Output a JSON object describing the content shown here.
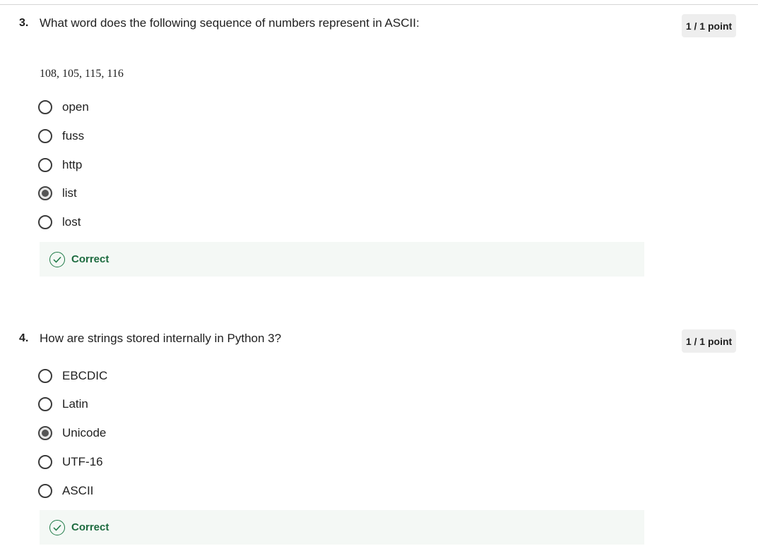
{
  "questions": [
    {
      "number": "3.",
      "text": "What word does the following sequence of numbers represent in ASCII:",
      "points": "1 / 1 point",
      "sub_text": "108, 105, 115, 116",
      "options": [
        {
          "label": "open",
          "selected": false
        },
        {
          "label": "fuss",
          "selected": false
        },
        {
          "label": "http",
          "selected": false
        },
        {
          "label": "list",
          "selected": true
        },
        {
          "label": "lost",
          "selected": false
        }
      ],
      "feedback": "Correct"
    },
    {
      "number": "4.",
      "text": "How are strings stored internally in Python 3?",
      "points": "1 / 1 point",
      "options": [
        {
          "label": "EBCDIC",
          "selected": false
        },
        {
          "label": "Latin",
          "selected": false
        },
        {
          "label": "Unicode",
          "selected": true
        },
        {
          "label": "UTF-16",
          "selected": false
        },
        {
          "label": "ASCII",
          "selected": false
        }
      ],
      "feedback": "Correct"
    }
  ],
  "colors": {
    "correct_green": "#1d6b3f",
    "feedback_bg": "#f4f8f5",
    "points_bg": "#eeeeee"
  },
  "icons": {
    "feedback": "check-circle-icon"
  }
}
